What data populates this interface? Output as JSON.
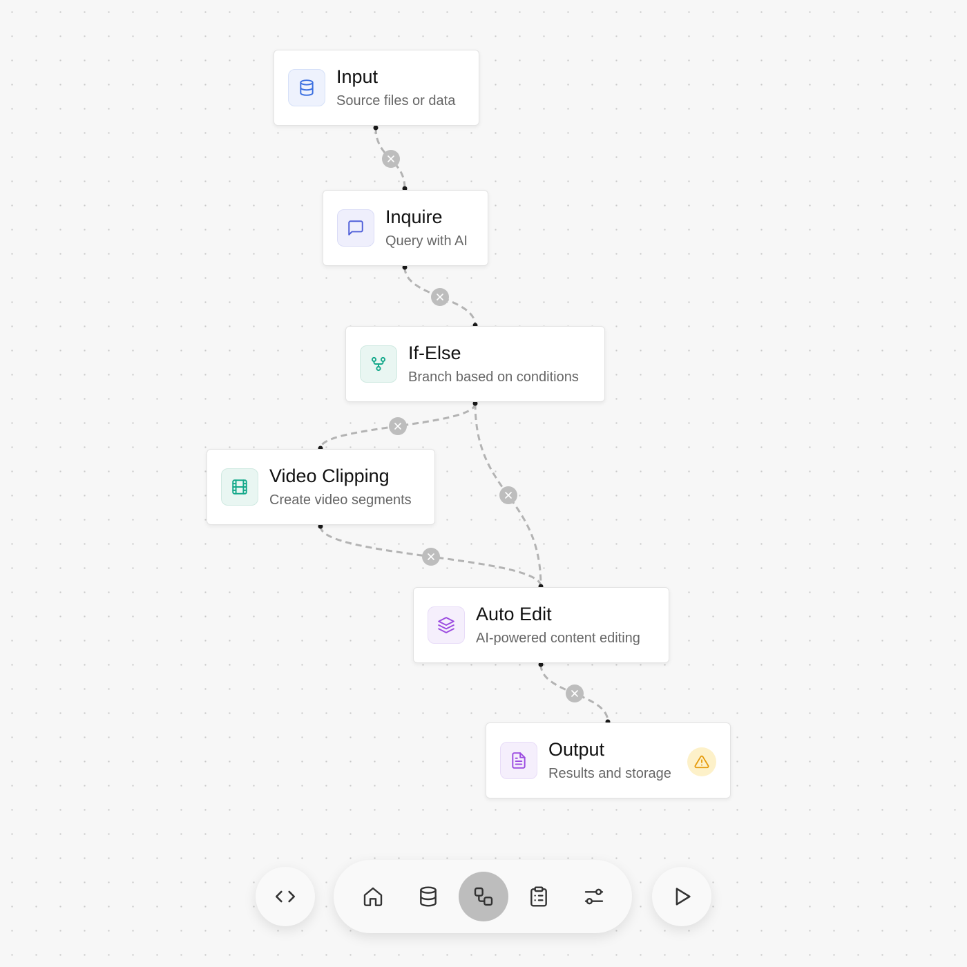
{
  "nodes": [
    {
      "id": "input",
      "title": "Input",
      "subtitle": "Source files or data",
      "icon": "database-icon",
      "accent": "#3b6fe0",
      "icon_bg": "#eef2fd"
    },
    {
      "id": "inquire",
      "title": "Inquire",
      "subtitle": "Query with AI",
      "icon": "message-square-icon",
      "accent": "#4f5fd9",
      "icon_bg": "#efeffc"
    },
    {
      "id": "if-else",
      "title": "If-Else",
      "subtitle": "Branch based on conditions",
      "icon": "git-branch-icon",
      "accent": "#14a88a",
      "icon_bg": "#e9f6f2"
    },
    {
      "id": "video-clipping",
      "title": "Video Clipping",
      "subtitle": "Create video segments",
      "icon": "film-icon",
      "accent": "#14a88a",
      "icon_bg": "#e9f6f2"
    },
    {
      "id": "auto-edit",
      "title": "Auto Edit",
      "subtitle": "AI-powered content editing",
      "icon": "layers-icon",
      "accent": "#9b4be0",
      "icon_bg": "#f5effc"
    },
    {
      "id": "output",
      "title": "Output",
      "subtitle": "Results and storage",
      "icon": "file-text-icon",
      "accent": "#9b4be0",
      "icon_bg": "#f5effc",
      "warning_icon": "alert-triangle-icon",
      "warning_color": "#e59a0b"
    }
  ],
  "edges": [
    {
      "from": "input",
      "to": "inquire"
    },
    {
      "from": "inquire",
      "to": "if-else"
    },
    {
      "from": "if-else",
      "to": "video-clipping"
    },
    {
      "from": "if-else",
      "to": "auto-edit"
    },
    {
      "from": "video-clipping",
      "to": "auto-edit"
    },
    {
      "from": "auto-edit",
      "to": "output"
    }
  ],
  "toolbar": {
    "left_button_icon": "code-icon",
    "items": [
      "home-icon",
      "database-icon",
      "workflow-icon",
      "clipboard-list-icon",
      "sliders-icon"
    ],
    "active_item": "workflow-icon",
    "right_button_icon": "play-icon"
  },
  "colors": {
    "canvas_bg": "#f7f7f7",
    "grid_dot": "#c9c9c9",
    "edge": "#b3b3b3",
    "active_tool_bg": "#bdbdbd"
  }
}
